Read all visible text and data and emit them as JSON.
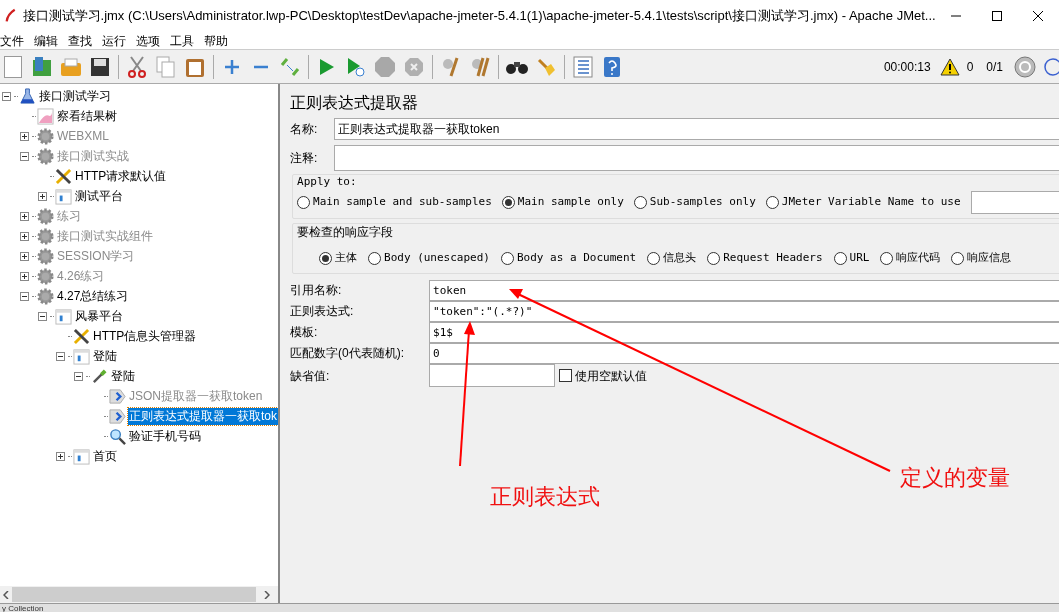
{
  "window": {
    "title": "接口测试学习.jmx (C:\\Users\\Administrator.lwp-PC\\Desktop\\testDev\\apache-jmeter-5.4.1(1)\\apache-jmeter-5.4.1\\tests\\script\\接口测试学习.jmx) - Apache JMet..."
  },
  "menu": [
    "文件",
    "编辑",
    "查找",
    "运行",
    "选项",
    "工具",
    "帮助"
  ],
  "toolbar": {
    "timer": "00:00:13",
    "warnings": "0",
    "threads": "0/1"
  },
  "tree": [
    {
      "label": "接口测试学习",
      "kind": "testplan",
      "disabled": false,
      "selected": false,
      "expanded": true,
      "children": [
        {
          "label": "察看结果树",
          "kind": "listener",
          "disabled": false,
          "selected": false
        },
        {
          "label": "WEBXML",
          "kind": "threadgroup",
          "disabled": true,
          "selected": false,
          "expanded": false
        },
        {
          "label": "接口测试实战",
          "kind": "threadgroup",
          "disabled": true,
          "selected": false,
          "expanded": true,
          "children": [
            {
              "label": "HTTP请求默认值",
              "kind": "config",
              "disabled": false,
              "selected": false
            },
            {
              "label": "测试平台",
              "kind": "controller",
              "disabled": false,
              "selected": false,
              "expanded": false
            }
          ]
        },
        {
          "label": "练习",
          "kind": "threadgroup",
          "disabled": true,
          "selected": false,
          "expanded": false
        },
        {
          "label": "接口测试实战组件",
          "kind": "threadgroup",
          "disabled": true,
          "selected": false,
          "expanded": false
        },
        {
          "label": "SESSION学习",
          "kind": "threadgroup",
          "disabled": true,
          "selected": false,
          "expanded": false
        },
        {
          "label": "4.26练习",
          "kind": "threadgroup",
          "disabled": true,
          "selected": false,
          "expanded": false
        },
        {
          "label": "4.27总结练习",
          "kind": "threadgroup",
          "disabled": false,
          "selected": false,
          "expanded": true,
          "children": [
            {
              "label": "风暴平台",
              "kind": "controller",
              "disabled": false,
              "selected": false,
              "expanded": true,
              "children": [
                {
                  "label": "HTTP信息头管理器",
                  "kind": "config",
                  "disabled": false,
                  "selected": false
                },
                {
                  "label": "登陆",
                  "kind": "controller",
                  "disabled": false,
                  "selected": false,
                  "expanded": true,
                  "children": [
                    {
                      "label": "登陆",
                      "kind": "sampler",
                      "disabled": false,
                      "selected": false,
                      "expanded": true,
                      "children": [
                        {
                          "label": "JSON提取器一获取token",
                          "kind": "extractor",
                          "disabled": true,
                          "selected": false
                        },
                        {
                          "label": "正则表达式提取器一获取tok",
                          "kind": "extractor",
                          "disabled": false,
                          "selected": true
                        },
                        {
                          "label": "验证手机号码",
                          "kind": "assertion",
                          "disabled": false,
                          "selected": false
                        }
                      ]
                    }
                  ]
                },
                {
                  "label": "首页",
                  "kind": "controller",
                  "disabled": false,
                  "selected": false,
                  "expanded": false
                }
              ]
            }
          ]
        }
      ]
    }
  ],
  "panel": {
    "title": "正则表达式提取器",
    "name": {
      "label": "名称:",
      "value": "正则表达式提取器一获取token"
    },
    "comment": {
      "label": "注释:"
    },
    "apply_to": {
      "legend": "Apply to:",
      "options": [
        {
          "label": "Main sample and sub-samples",
          "selected": false
        },
        {
          "label": "Main sample only",
          "selected": true
        },
        {
          "label": "Sub-samples only",
          "selected": false
        },
        {
          "label": "JMeter Variable Name to use",
          "selected": false
        }
      ]
    },
    "field_to_check": {
      "legend": "要检查的响应字段",
      "options": [
        {
          "label": "主体",
          "selected": true
        },
        {
          "label": "Body (unescaped)",
          "selected": false
        },
        {
          "label": "Body as a Document",
          "selected": false
        },
        {
          "label": "信息头",
          "selected": false
        },
        {
          "label": "Request Headers",
          "selected": false
        },
        {
          "label": "URL",
          "selected": false
        },
        {
          "label": "响应代码",
          "selected": false
        },
        {
          "label": "响应信息",
          "selected": false
        }
      ]
    },
    "fields": [
      {
        "label": "引用名称:",
        "value": "token"
      },
      {
        "label": "正则表达式:",
        "value": "\"token\":\"(.*?)\""
      },
      {
        "label": "模板:",
        "value": "$1$"
      },
      {
        "label": "匹配数字(0代表随机):",
        "value": "0"
      }
    ],
    "default": {
      "label": "缺省值:",
      "checkbox": {
        "label": "使用空默认值",
        "checked": false
      }
    }
  },
  "annotations": [
    {
      "label": "正则表达式"
    },
    {
      "label": "定义的变量"
    }
  ],
  "status_bar": {
    "text": "y Collection"
  }
}
